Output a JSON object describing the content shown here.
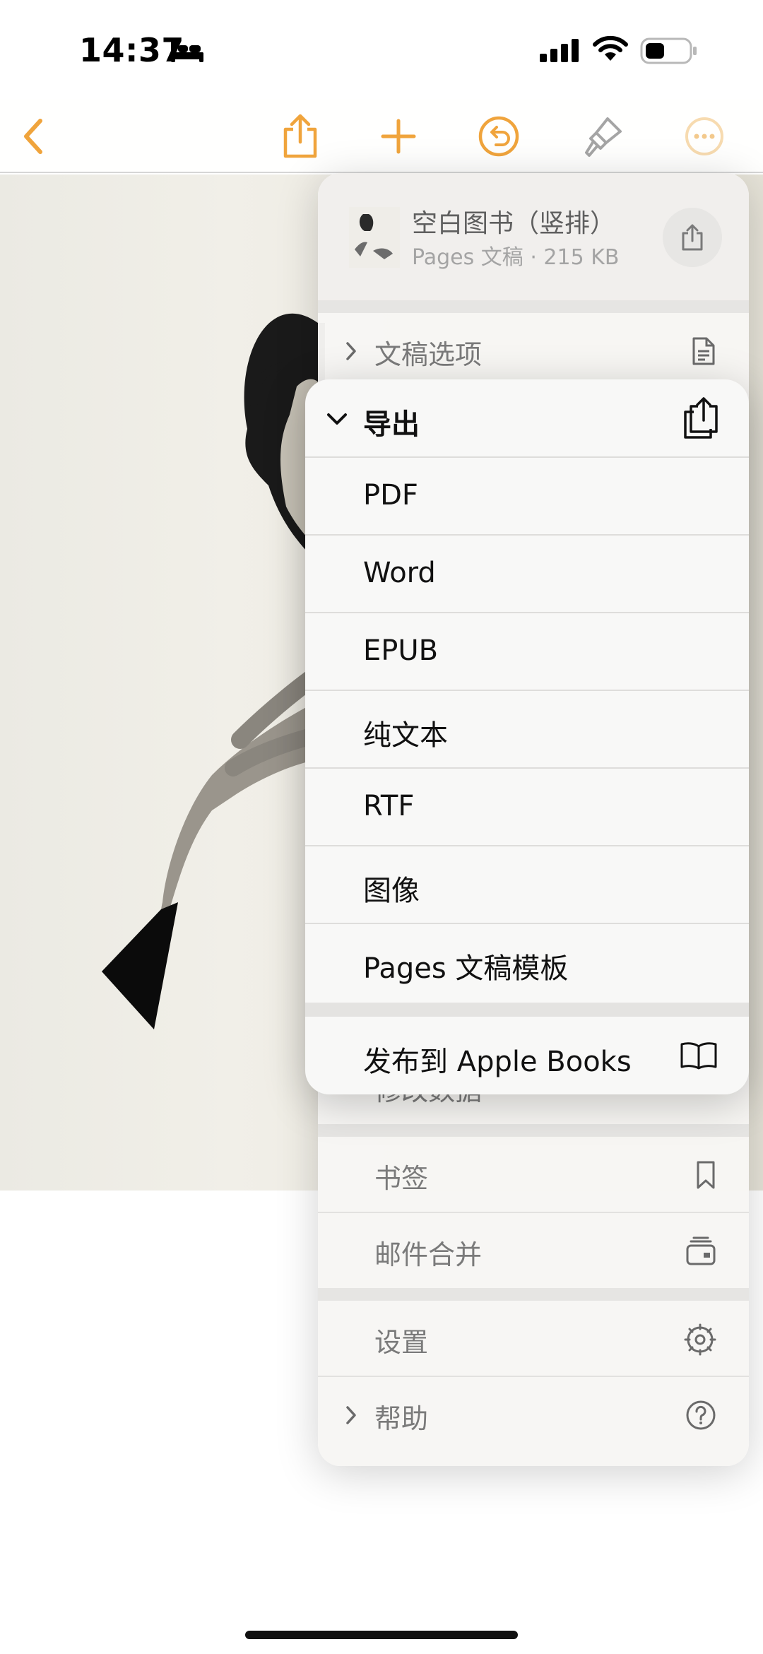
{
  "status_bar": {
    "time": "14:37"
  },
  "toolbar": {
    "accent": "#f0a43c"
  },
  "file": {
    "title": "空白图书（竖排）",
    "subtitle": "Pages 文稿 · 215 KB"
  },
  "menu": {
    "document_options": "文稿选项",
    "hidden_row": "修改数据",
    "bookmarks": "书签",
    "mail_merge": "邮件合并",
    "settings": "设置",
    "help": "帮助"
  },
  "export": {
    "header": "导出",
    "items": [
      "PDF",
      "Word",
      "EPUB",
      "纯文本",
      "RTF",
      "图像",
      "Pages 文稿模板"
    ],
    "publish": "发布到 Apple Books"
  }
}
